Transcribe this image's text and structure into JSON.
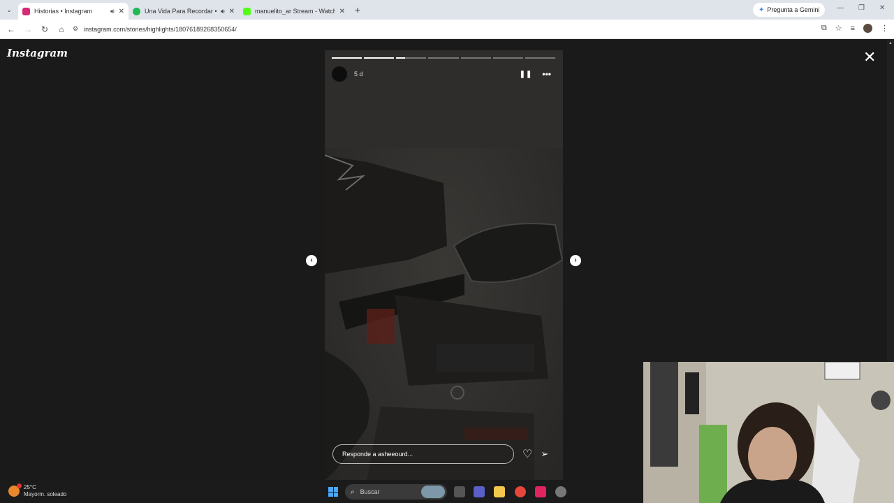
{
  "browser": {
    "tabs": [
      {
        "title": "Historias • Instagram",
        "active": true,
        "audio": true,
        "favicon_color": "#d62976"
      },
      {
        "title": "Una Vida Para Recordar • P",
        "active": false,
        "audio": true,
        "favicon_color": "#1db954"
      },
      {
        "title": "manuelito_ar Stream - Watch Li",
        "active": false,
        "audio": false,
        "favicon_color": "#53fc18"
      }
    ],
    "gemini_label": "Pregunta a Gemini",
    "url": "instagram.com/stories/highlights/18076189268350654/"
  },
  "instagram": {
    "logo_text": "Instagram",
    "story": {
      "time": "5 d",
      "segments": 7,
      "current_segment": 3,
      "current_progress": 0.3,
      "reply_placeholder": "Responde a asheeourd..."
    }
  },
  "taskbar": {
    "temperature": "25°C",
    "weather": "Mayorm. soleado",
    "search_placeholder": "Buscar"
  },
  "colors": {
    "page_bg": "#1a1a1a",
    "browser_tabbar": "#dfe3ea",
    "accent": "#4a7ef0"
  }
}
